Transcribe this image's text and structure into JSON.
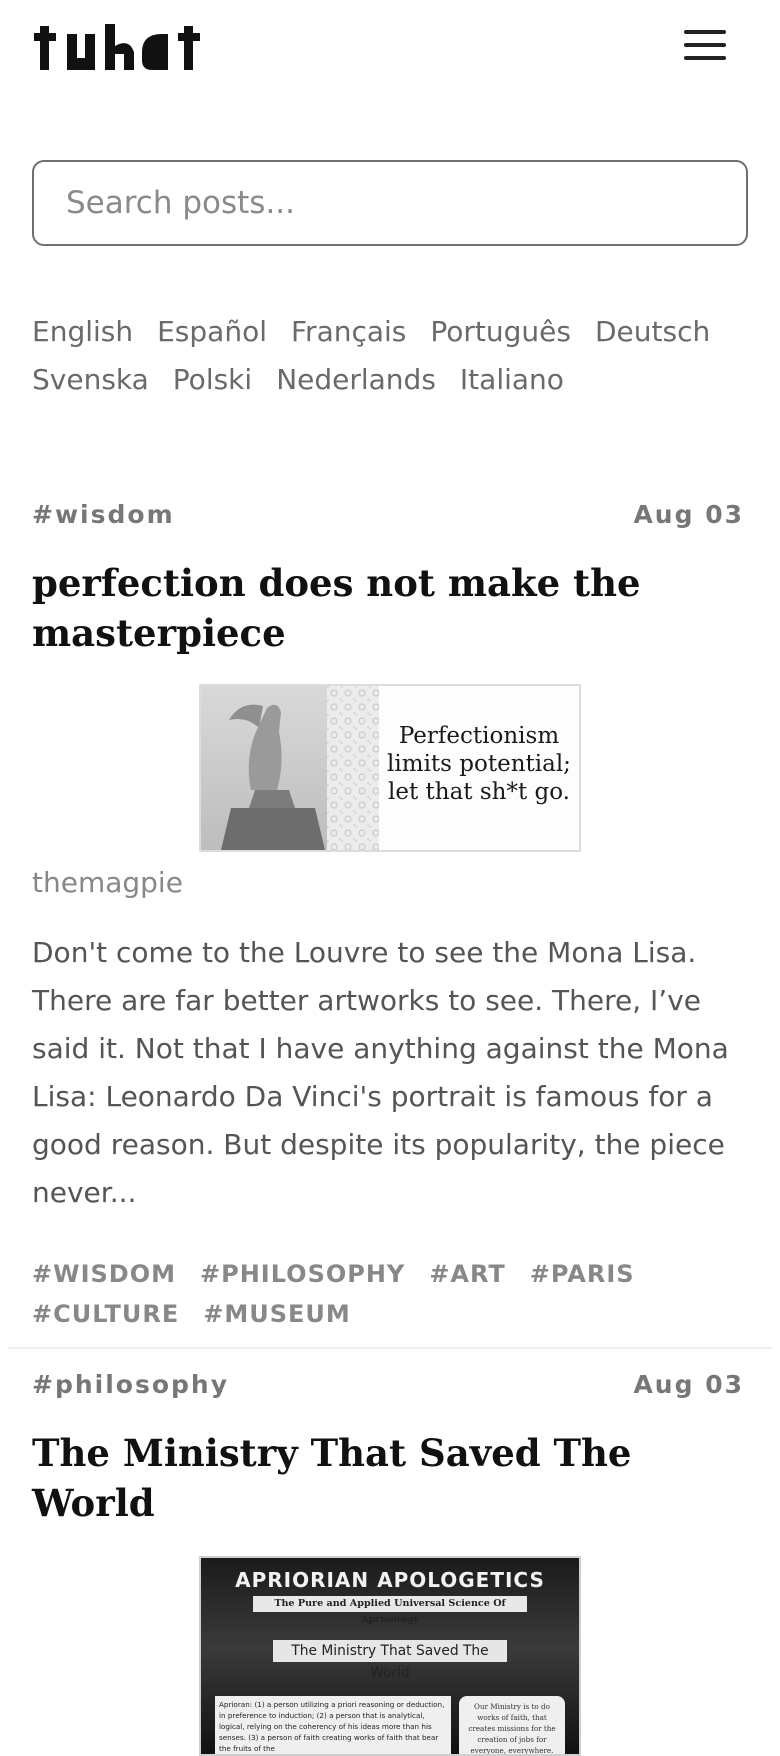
{
  "header": {
    "logo_text": "tuhat",
    "menu_icon": "hamburger-icon"
  },
  "search": {
    "placeholder": "Search posts...",
    "value": ""
  },
  "languages": [
    "English",
    "Español",
    "Français",
    "Português",
    "Deutsch",
    "Svenska",
    "Polski",
    "Nederlands",
    "Italiano"
  ],
  "posts": [
    {
      "category": "#wisdom",
      "date": "Aug 03",
      "title": "perfection does not make the masterpiece",
      "thumbnail_text": [
        "Perfectionism",
        "limits potential;",
        "let that sh*t go."
      ],
      "author": "themagpie",
      "excerpt": "Don't come to the Louvre to see the Mona Lisa. There are far better artworks to see. There, I’ve said it. Not that I have anything against the Mona Lisa: Leonardo Da Vinci's portrait is famous for a good reason. But despite its popularity, the piece never...",
      "tags": [
        "#WISDOM",
        "#PHILOSOPHY",
        "#ART",
        "#PARIS",
        "#CULTURE",
        "#MUSEUM"
      ]
    },
    {
      "category": "#philosophy",
      "date": "Aug 03",
      "title": "The Ministry That Saved The World",
      "thumbnail_text": {
        "heading": "APRIORIAN APOLOGETICS",
        "subheading": "The Pure and Applied Universal Science Of Aprioology",
        "banner": "The Ministry That Saved The World",
        "body": "Aprioran: (1) a person utilizing a priori reasoning or deduction, in preference to induction; (2) a person that is analytical, logical, relying on the coherency of his ideas more than his senses. (3) a person of faith creating works of faith that bear the fruits of the",
        "side": "Our Ministry is to do works of faith, that creates missions for the creation of jobs for everyone, everywhere."
      }
    }
  ]
}
